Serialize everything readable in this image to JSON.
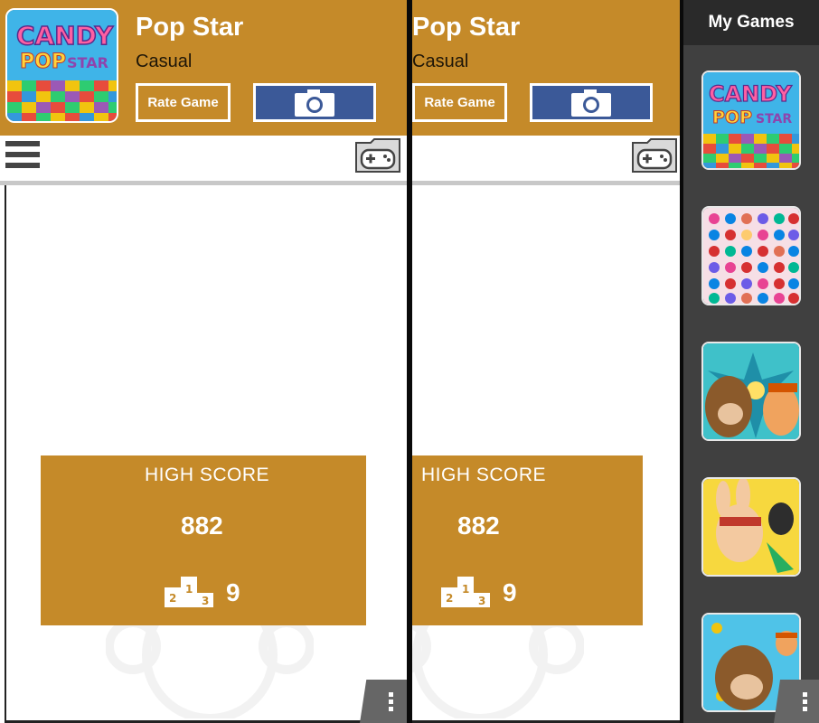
{
  "game": {
    "title": "Pop Star",
    "genre": "Casual",
    "rate_label": "Rate Game"
  },
  "high_score": {
    "label": "HIGH SCORE",
    "value": "882",
    "rank": "9",
    "podium_digits": [
      "2",
      "1",
      "3"
    ]
  },
  "sidebar": {
    "title": "My Games",
    "games": [
      {
        "icon": "candy-pop-star-icon"
      },
      {
        "icon": "jewel-match-icon"
      },
      {
        "icon": "monkey-fight-icon"
      },
      {
        "icon": "bunny-slingshot-icon"
      },
      {
        "icon": "monkey-coins-icon"
      }
    ]
  },
  "colors": {
    "accent": "#c58a29",
    "facebook": "#3b5998",
    "sidebar": "#404040"
  }
}
